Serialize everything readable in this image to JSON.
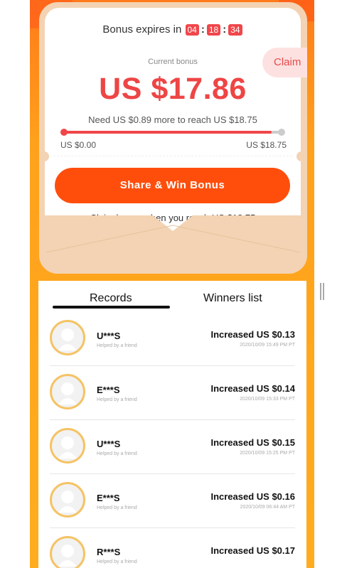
{
  "bonus": {
    "expires_label": "Bonus expires in",
    "timer": {
      "hours": "04",
      "minutes": "18",
      "seconds": "34"
    },
    "current_label": "Current bonus",
    "claim_label": "Claim",
    "amount": "US $17.86",
    "need_text": "Need US $0.89 more to reach US $18.75",
    "progress_fraction": 0.95,
    "range_min": "US $0.00",
    "range_max": "US $18.75",
    "share_button": "Share & Win Bonus",
    "claim_note": "Claim bonus when you reach US $18.75"
  },
  "tabs": {
    "records": "Records",
    "winners": "Winners list"
  },
  "records": [
    {
      "name": "U***S",
      "sub": "Helped by a friend",
      "increase": "Increased US $0.13",
      "time": "2020/10/09 15:49 PM PT"
    },
    {
      "name": "E***S",
      "sub": "Helped by a friend",
      "increase": "Increased US $0.14",
      "time": "2020/10/09 15:33 PM PT"
    },
    {
      "name": "U***S",
      "sub": "Helped by a friend",
      "increase": "Increased US $0.15",
      "time": "2020/10/09 15:25 PM PT"
    },
    {
      "name": "E***S",
      "sub": "Helped by a friend",
      "increase": "Increased US $0.16",
      "time": "2020/10/09 06:44 AM PT"
    },
    {
      "name": "R***S",
      "sub": "Helped by a friend",
      "increase": "Increased US $0.17",
      "time": ""
    }
  ],
  "colors": {
    "accent": "#ee4545",
    "button": "#ff4e0c",
    "avatar_ring": "#f5c365",
    "background": "#ffa11c"
  }
}
